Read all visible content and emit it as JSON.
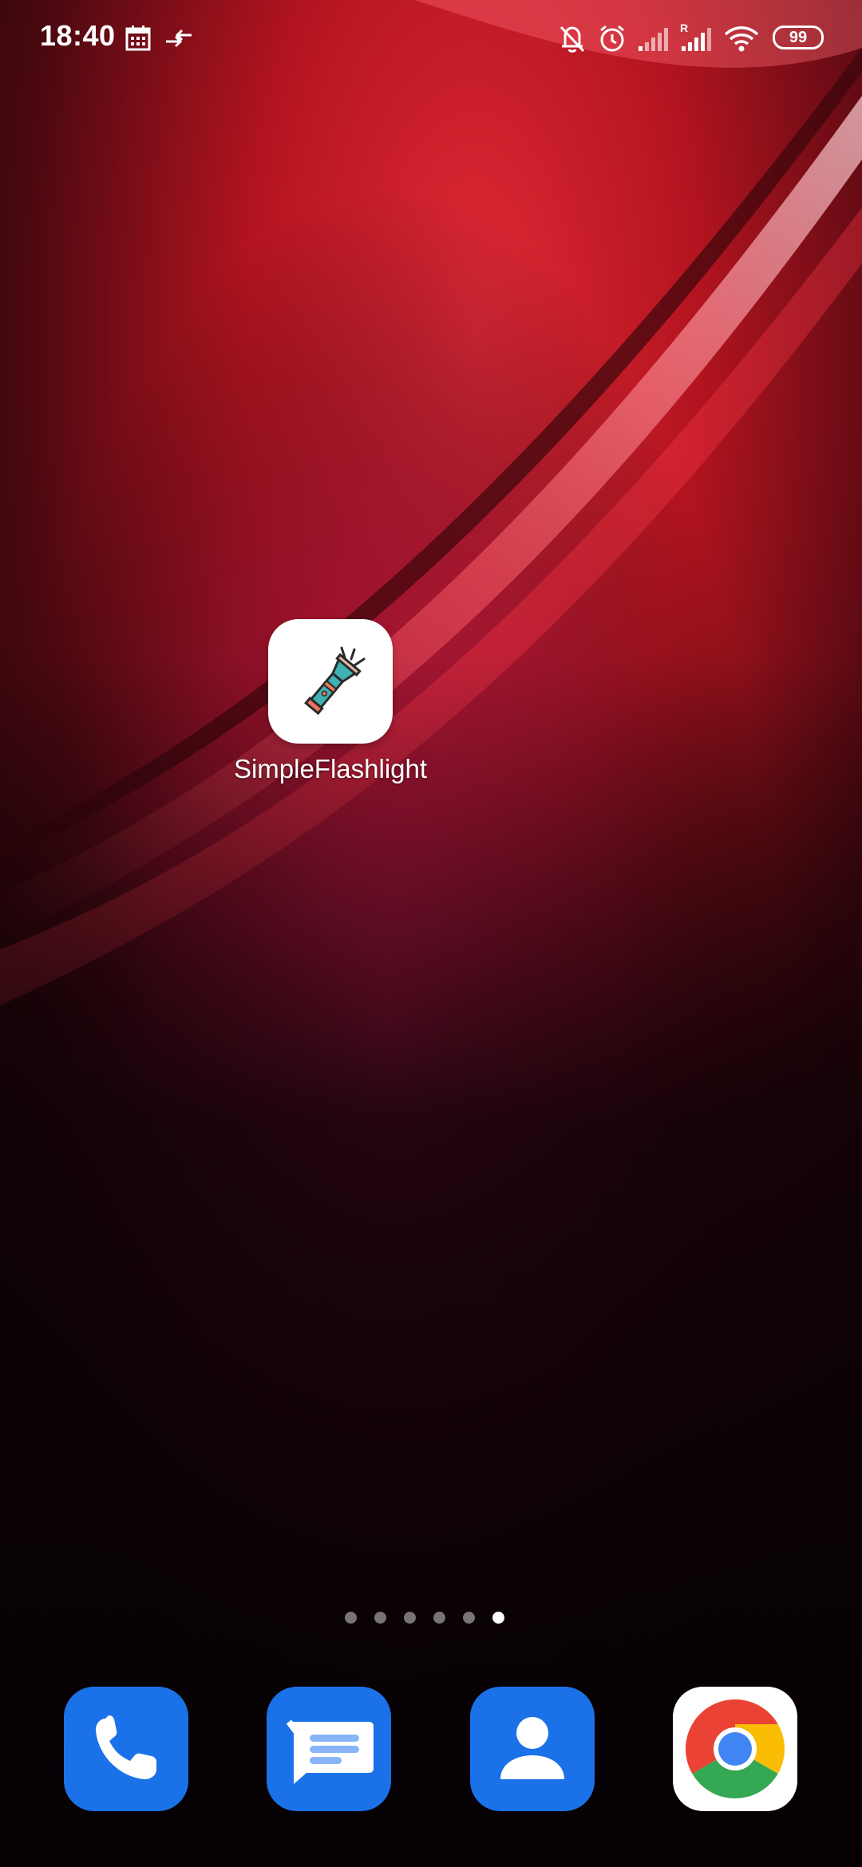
{
  "status_bar": {
    "time": "18:40",
    "icons": [
      "calendar-icon",
      "data-transfer-icon",
      "mute-icon",
      "alarm-icon",
      "signal-icon",
      "roaming-signal-icon",
      "wifi-icon",
      "battery-icon"
    ],
    "roaming_label": "R",
    "battery_level": "99"
  },
  "home": {
    "apps": [
      {
        "label": "SimpleFlashlight",
        "icon": "flashlight-icon"
      }
    ],
    "page_indicator": {
      "total": 6,
      "active": 6
    }
  },
  "dock": {
    "apps": [
      {
        "icon": "phone-icon",
        "color": "#1b72e8"
      },
      {
        "icon": "messages-icon",
        "color": "#1b72e8"
      },
      {
        "icon": "contacts-icon",
        "color": "#1b72e8"
      },
      {
        "icon": "chrome-icon",
        "color": "#ffffff"
      }
    ]
  },
  "colors": {
    "wallpaper_primary": "#d6202e",
    "wallpaper_dark": "#0a0306",
    "wallpaper_pink": "#c51b4f"
  }
}
